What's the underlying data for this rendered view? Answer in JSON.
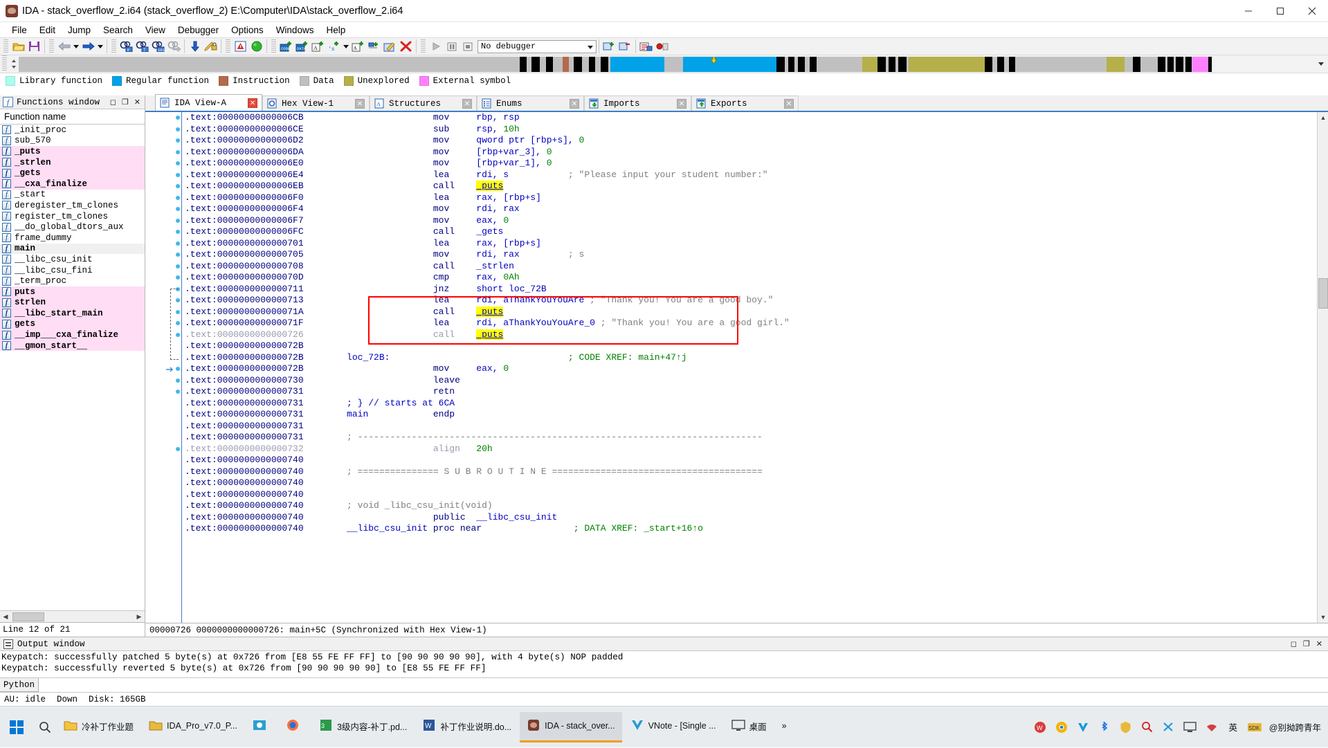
{
  "window": {
    "title": "IDA - stack_overflow_2.i64 (stack_overflow_2) E:\\Computer\\IDA\\stack_overflow_2.i64",
    "app_icon": "ida-logo-icon",
    "minimize": "minimize-icon",
    "maximize": "maximize-icon",
    "close": "close-icon"
  },
  "menubar": [
    {
      "label": "File"
    },
    {
      "label": "Edit"
    },
    {
      "label": "Jump"
    },
    {
      "label": "Search"
    },
    {
      "label": "View"
    },
    {
      "label": "Debugger"
    },
    {
      "label": "Options"
    },
    {
      "label": "Windows"
    },
    {
      "label": "Help"
    }
  ],
  "toolbar": {
    "debugger_select": "No debugger",
    "icons": [
      "open-file-icon",
      "save-icon",
      "back-arrow-icon",
      "back-dropdown-icon",
      "forward-arrow-icon",
      "forward-dropdown-icon",
      "search-hash-icon",
      "search-text-icon",
      "search-binary-icon",
      "search-next-icon",
      "jump-down-icon",
      "edit-lock-icon",
      "warning-icon",
      "green-play-icon",
      "make-code-icon",
      "make-data-icon",
      "make-ascii-icon",
      "make-struct-icon",
      "make-dropdown-icon",
      "make-array-icon",
      "undefine-icon",
      "delete-red-x-icon",
      "run-icon",
      "pause-icon",
      "stop-icon",
      "attach-icon",
      "detach-icon",
      "tracing-icon",
      "breakpoints-icon"
    ]
  },
  "legend": [
    {
      "label": "Library function",
      "color": "#aaffee"
    },
    {
      "label": "Regular function",
      "color": "#00a2e8"
    },
    {
      "label": "Instruction",
      "color": "#b5694a"
    },
    {
      "label": "Data",
      "color": "#c0c0c0"
    },
    {
      "label": "Unexplored",
      "color": "#b5b04a"
    },
    {
      "label": "External symbol",
      "color": "#ff80ff"
    }
  ],
  "functions_window": {
    "title": "Functions window",
    "icon": "functions-window-icon",
    "column_header": "Function name",
    "status": "Line 12 of 21",
    "items": [
      {
        "name": "_init_proc",
        "style": "normal"
      },
      {
        "name": "sub_570",
        "style": "normal"
      },
      {
        "name": "_puts",
        "style": "library"
      },
      {
        "name": "_strlen",
        "style": "library"
      },
      {
        "name": "_gets",
        "style": "library"
      },
      {
        "name": "__cxa_finalize",
        "style": "library"
      },
      {
        "name": "_start",
        "style": "normal"
      },
      {
        "name": "deregister_tm_clones",
        "style": "normal"
      },
      {
        "name": "register_tm_clones",
        "style": "normal"
      },
      {
        "name": "__do_global_dtors_aux",
        "style": "normal"
      },
      {
        "name": "frame_dummy",
        "style": "normal"
      },
      {
        "name": "main",
        "style": "selected"
      },
      {
        "name": "__libc_csu_init",
        "style": "normal"
      },
      {
        "name": "__libc_csu_fini",
        "style": "normal"
      },
      {
        "name": "_term_proc",
        "style": "normal"
      },
      {
        "name": "puts",
        "style": "library"
      },
      {
        "name": "strlen",
        "style": "library"
      },
      {
        "name": "__libc_start_main",
        "style": "library"
      },
      {
        "name": "gets",
        "style": "library"
      },
      {
        "name": "__imp___cxa_finalize",
        "style": "library"
      },
      {
        "name": "__gmon_start__",
        "style": "library"
      }
    ]
  },
  "tabs": [
    {
      "label": "IDA View-A",
      "icon": "ida-view-icon",
      "active": true
    },
    {
      "label": "Hex View-1",
      "icon": "hex-view-icon",
      "active": false
    },
    {
      "label": "Structures",
      "icon": "structures-icon",
      "active": false
    },
    {
      "label": "Enums",
      "icon": "enums-icon",
      "active": false
    },
    {
      "label": "Imports",
      "icon": "imports-icon",
      "active": false
    },
    {
      "label": "Exports",
      "icon": "exports-icon",
      "active": false
    }
  ],
  "disassembly": {
    "status": "00000726 0000000000000726: main+5C (Synchronized with Hex View-1)",
    "lines": [
      {
        "addr": ".text:00000000000006CB",
        "label": "",
        "mnem": "mov",
        "ops": "rbp, rsp",
        "cmt": "",
        "dot": true,
        "dim": false
      },
      {
        "addr": ".text:00000000000006CE",
        "label": "",
        "mnem": "sub",
        "ops": "rsp, 10h",
        "cmt": "",
        "dot": true,
        "dim": false
      },
      {
        "addr": ".text:00000000000006D2",
        "label": "",
        "mnem": "mov",
        "ops": "qword ptr [rbp+s], 0",
        "cmt": "",
        "dot": true,
        "dim": false
      },
      {
        "addr": ".text:00000000000006DA",
        "label": "",
        "mnem": "mov",
        "ops": "[rbp+var_3], 0",
        "cmt": "",
        "dot": true,
        "dim": false
      },
      {
        "addr": ".text:00000000000006E0",
        "label": "",
        "mnem": "mov",
        "ops": "[rbp+var_1], 0",
        "cmt": "",
        "dot": true,
        "dim": false
      },
      {
        "addr": ".text:00000000000006E4",
        "label": "",
        "mnem": "lea",
        "ops": "rdi, s",
        "cmt": "; \"Please input your student number:\"",
        "dot": true,
        "dim": false
      },
      {
        "addr": ".text:00000000000006EB",
        "label": "",
        "mnem": "call",
        "ops": "_puts",
        "cmt": "",
        "dot": true,
        "dim": false,
        "hl": true
      },
      {
        "addr": ".text:00000000000006F0",
        "label": "",
        "mnem": "lea",
        "ops": "rax, [rbp+s]",
        "cmt": "",
        "dot": true,
        "dim": false
      },
      {
        "addr": ".text:00000000000006F4",
        "label": "",
        "mnem": "mov",
        "ops": "rdi, rax",
        "cmt": "",
        "dot": true,
        "dim": false
      },
      {
        "addr": ".text:00000000000006F7",
        "label": "",
        "mnem": "mov",
        "ops": "eax, 0",
        "cmt": "",
        "dot": true,
        "dim": false
      },
      {
        "addr": ".text:00000000000006FC",
        "label": "",
        "mnem": "call",
        "ops": "_gets",
        "cmt": "",
        "dot": true,
        "dim": false
      },
      {
        "addr": ".text:0000000000000701",
        "label": "",
        "mnem": "lea",
        "ops": "rax, [rbp+s]",
        "cmt": "",
        "dot": true,
        "dim": false
      },
      {
        "addr": ".text:0000000000000705",
        "label": "",
        "mnem": "mov",
        "ops": "rdi, rax",
        "cmt": "; s",
        "dot": true,
        "dim": false
      },
      {
        "addr": ".text:0000000000000708",
        "label": "",
        "mnem": "call",
        "ops": "_strlen",
        "cmt": "",
        "dot": true,
        "dim": false
      },
      {
        "addr": ".text:000000000000070D",
        "label": "",
        "mnem": "cmp",
        "ops": "rax, 0Ah",
        "cmt": "",
        "dot": true,
        "dim": false
      },
      {
        "addr": ".text:0000000000000711",
        "label": "",
        "mnem": "jnz",
        "ops": "short loc_72B",
        "cmt": "",
        "dot": true,
        "dim": false
      },
      {
        "addr": ".text:0000000000000713",
        "label": "",
        "mnem": "lea",
        "ops": "rdi, aThankYouYouAre",
        "cmt": "; \"Thank you! You are a good boy.\"",
        "dot": true,
        "dim": false
      },
      {
        "addr": ".text:000000000000071A",
        "label": "",
        "mnem": "call",
        "ops": "_puts",
        "cmt": "",
        "dot": true,
        "dim": false,
        "hl": true
      },
      {
        "addr": ".text:000000000000071F",
        "label": "",
        "mnem": "lea",
        "ops": "rdi, aThankYouYouAre_0",
        "cmt": "; \"Thank you! You are a good girl.\"",
        "dot": true,
        "dim": false
      },
      {
        "addr": ".text:0000000000000726",
        "label": "",
        "mnem": "call",
        "ops": "_puts",
        "cmt": "",
        "dot": true,
        "dim": true,
        "hl": true
      },
      {
        "addr": ".text:000000000000072B",
        "label": "",
        "mnem": "",
        "ops": "",
        "cmt": "",
        "dot": false,
        "dim": false
      },
      {
        "addr": ".text:000000000000072B",
        "label": "loc_72B:",
        "mnem": "",
        "ops": "",
        "cmt": "; CODE XREF: main+47↑j",
        "dot": false,
        "dim": false,
        "xref": true
      },
      {
        "addr": ".text:000000000000072B",
        "label": "",
        "mnem": "mov",
        "ops": "eax, 0",
        "cmt": "",
        "dot": true,
        "dim": false,
        "arrow": true
      },
      {
        "addr": ".text:0000000000000730",
        "label": "",
        "mnem": "leave",
        "ops": "",
        "cmt": "",
        "dot": true,
        "dim": false
      },
      {
        "addr": ".text:0000000000000731",
        "label": "",
        "mnem": "retn",
        "ops": "",
        "cmt": "",
        "dot": true,
        "dim": false
      },
      {
        "addr": ".text:0000000000000731",
        "label": "",
        "mnem": "",
        "ops": "",
        "cmt": "; } // starts at 6CA",
        "dot": false,
        "dim": false,
        "bluecmt": true
      },
      {
        "addr": ".text:0000000000000731",
        "label": "main",
        "mnem": "endp",
        "ops": "",
        "cmt": "",
        "dot": false,
        "dim": false
      },
      {
        "addr": ".text:0000000000000731",
        "label": "",
        "mnem": "",
        "ops": "",
        "cmt": "",
        "dot": false,
        "dim": false
      },
      {
        "addr": ".text:0000000000000731",
        "label": "",
        "mnem": "",
        "ops": "",
        "cmt": "; ---------------------------------------------------------------------------",
        "dot": false,
        "dim": false
      },
      {
        "addr": ".text:0000000000000732",
        "label": "",
        "mnem": "align",
        "ops": "20h",
        "cmt": "",
        "dot": true,
        "dim": true
      },
      {
        "addr": ".text:0000000000000740",
        "label": "",
        "mnem": "",
        "ops": "",
        "cmt": "",
        "dot": false,
        "dim": false
      },
      {
        "addr": ".text:0000000000000740",
        "label": "",
        "mnem": "",
        "ops": "",
        "cmt": "; =============== S U B R O U T I N E =======================================",
        "dot": false,
        "dim": false
      },
      {
        "addr": ".text:0000000000000740",
        "label": "",
        "mnem": "",
        "ops": "",
        "cmt": "",
        "dot": false,
        "dim": false
      },
      {
        "addr": ".text:0000000000000740",
        "label": "",
        "mnem": "",
        "ops": "",
        "cmt": "",
        "dot": false,
        "dim": false
      },
      {
        "addr": ".text:0000000000000740",
        "label": "",
        "mnem": "",
        "ops": "",
        "cmt": "; void _libc_csu_init(void)",
        "dot": false,
        "dim": false
      },
      {
        "addr": ".text:0000000000000740",
        "label": "",
        "mnem": "public",
        "ops": "__libc_csu_init",
        "cmt": "",
        "dot": false,
        "dim": false
      },
      {
        "addr": ".text:0000000000000740",
        "label": "__libc_csu_init",
        "mnem": "proc near",
        "ops": "",
        "cmt": "; DATA XREF: _start+16↑o",
        "dot": false,
        "dim": false,
        "xref": true
      }
    ]
  },
  "output_window": {
    "title": "Output window",
    "icon": "output-window-icon",
    "lines": [
      "Keypatch: successfully patched 5 byte(s) at 0x726 from [E8 55 FE FF FF] to [90 90 90 90 90], with 4 byte(s) NOP padded",
      "Keypatch: successfully reverted 5 byte(s) at 0x726 from [90 90 90 90 90] to [E8 55 FE FF FF]"
    ],
    "input_label": "Python",
    "input_value": "",
    "status": [
      {
        "text": "AU:  idle"
      },
      {
        "text": "Down"
      },
      {
        "text": "Disk: 165GB"
      }
    ]
  },
  "taskbar": {
    "start_icon": "windows-start-icon",
    "search_icon": "search-icon",
    "items": [
      {
        "label": "冷补丁作业题",
        "icon": "explorer-icon",
        "active": false
      },
      {
        "label": "IDA_Pro_v7.0_P...",
        "icon": "folder-icon",
        "active": false
      },
      {
        "label": "",
        "icon": "xmind-icon",
        "active": false
      },
      {
        "label": "",
        "icon": "firefox-icon",
        "active": false
      },
      {
        "label": "3级内容-补丁.pd...",
        "icon": "pdf-icon",
        "active": false
      },
      {
        "label": "补丁作业说明.do...",
        "icon": "word-icon",
        "active": false
      },
      {
        "label": "IDA - stack_over...",
        "icon": "ida-logo-icon",
        "active": true
      },
      {
        "label": "VNote - [Single ...",
        "icon": "vnote-icon",
        "active": false
      },
      {
        "label": "桌面",
        "icon": "desktop-icon",
        "active": false
      }
    ],
    "overflow": "»",
    "tray": [
      {
        "icon": "wps-icon"
      },
      {
        "icon": "chrome-icon"
      },
      {
        "icon": "v2ray-icon"
      },
      {
        "icon": "bluetooth-icon"
      },
      {
        "icon": "shield-icon"
      },
      {
        "icon": "search-tray-icon"
      },
      {
        "icon": "ime-x-icon"
      },
      {
        "icon": "monitor-icon"
      },
      {
        "icon": "network-icon"
      },
      {
        "icon": "ime-en-icon",
        "text": "英"
      },
      {
        "icon": "sdk-icon"
      },
      {
        "icon": "user-name-icon",
        "text": "@别拗跨青年"
      }
    ]
  }
}
